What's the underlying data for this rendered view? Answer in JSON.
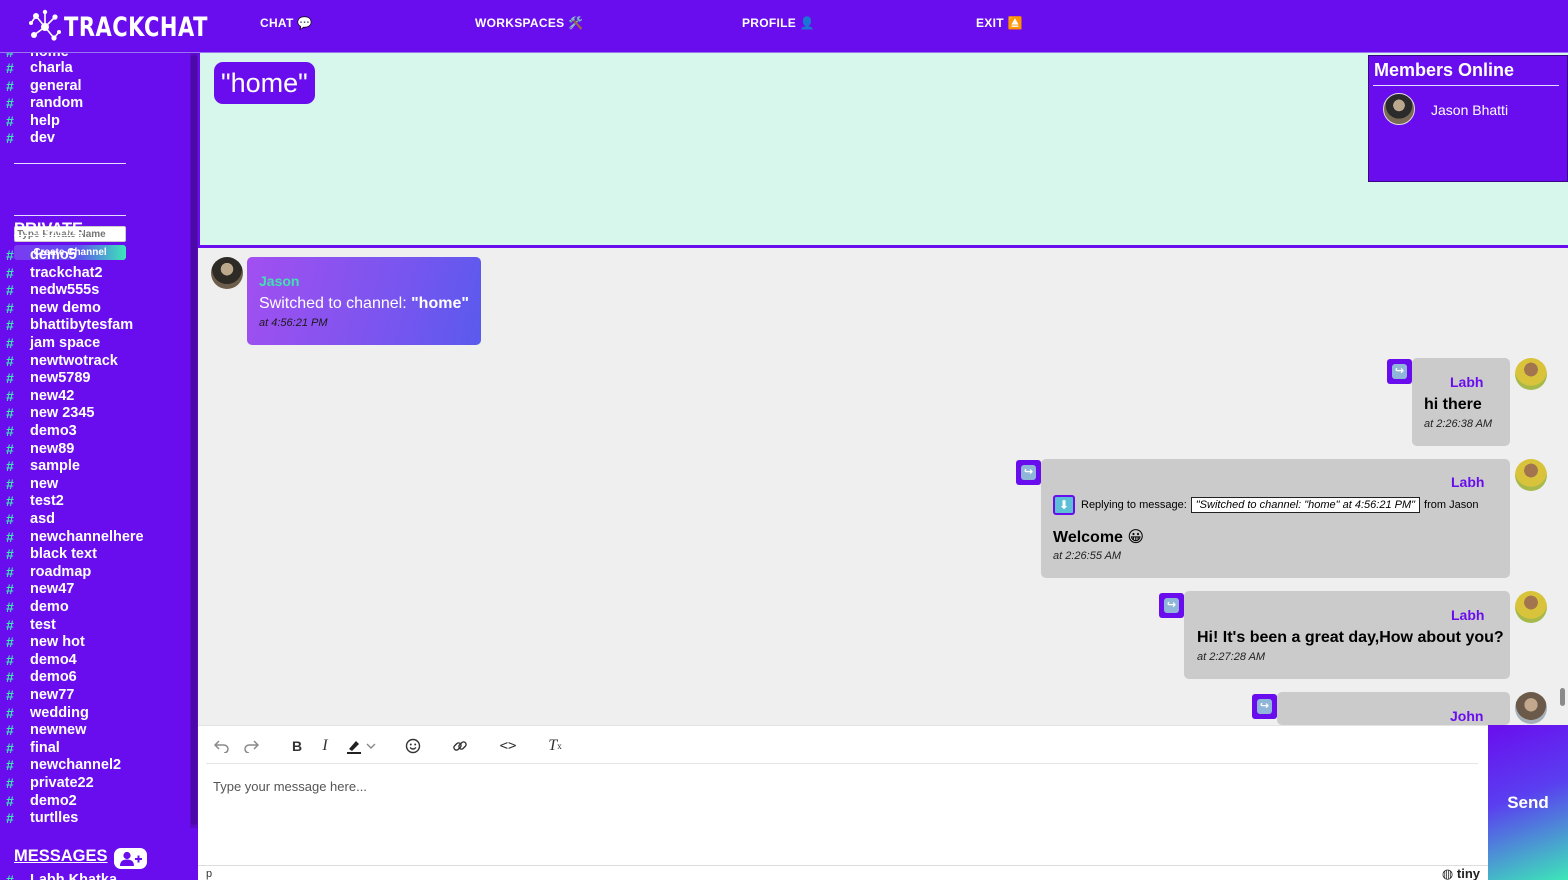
{
  "app": {
    "name": "TRACKCHAT"
  },
  "nav": [
    {
      "label": "CHAT 💬"
    },
    {
      "label": "WORKSPACES 🛠️"
    },
    {
      "label": "PROFILE 👤"
    },
    {
      "label": "EXIT ⏏️"
    }
  ],
  "sidebar": {
    "channels_partial_top": "home",
    "public_channels": [
      "charla",
      "general",
      "random",
      "help",
      "dev"
    ],
    "private_input_placeholder": "Type Private Name",
    "create_button": "Create Channel",
    "private_title": "PRIVATE",
    "private_channels": [
      "demo5",
      "trackchat2",
      "nedw555s",
      "new demo",
      "bhattibytesfam",
      "jam space",
      "newtwotrack",
      "new5789",
      "new42",
      "new 2345",
      "demo3",
      "new89",
      "sample",
      "new",
      "test2",
      "asd",
      "newchannelhere",
      "black text",
      "roadmap",
      "new47",
      "demo",
      "test",
      "new hot",
      "demo4",
      "demo6",
      "new77",
      "wedding",
      "newnew",
      "final",
      "newchannel2",
      "private22",
      "demo2",
      "turtlles"
    ],
    "messages_title": "MESSAGES",
    "dm_partial": "Labh Khatka",
    "hash": "#"
  },
  "header": {
    "channel": "\"home\"",
    "members_title": "Members Online",
    "members": [
      {
        "name": "Jason Bhatti"
      }
    ]
  },
  "messages": [
    {
      "author": "Jason",
      "text_prefix": "Switched to channel: ",
      "text_bold": "\"home\"",
      "time": "at 4:56:21 PM"
    },
    {
      "author": "Labh",
      "text": "hi there",
      "time": "at 2:26:38 AM"
    },
    {
      "author": "Labh",
      "reply_label": "Replying to message:",
      "reply_quote": "\"Switched to channel: \"home\" at 4:56:21 PM\"",
      "reply_from": "from Jason",
      "text": "Welcome 😀",
      "time": "at 2:26:55 AM"
    },
    {
      "author": "Labh",
      "text": "Hi! It's been a great day,How about you?",
      "time": "at 2:27:28 AM"
    },
    {
      "author": "John"
    }
  ],
  "editor": {
    "placeholder": "Type your message here...",
    "status_path": "p",
    "brand": "tiny",
    "send_label": "Send"
  },
  "colors": {
    "primary": "#6a0dee",
    "accent": "#3de7b8",
    "header_bg": "#d7f6ec",
    "bubble_out": "#cbcbcb"
  }
}
